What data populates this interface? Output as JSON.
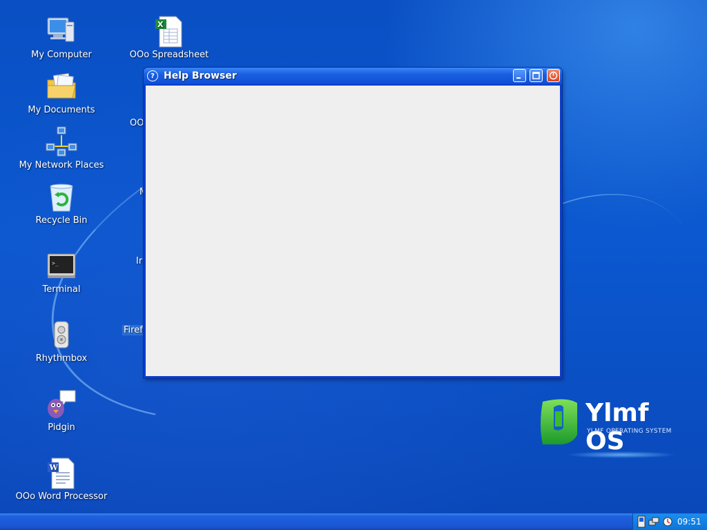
{
  "desktop": {
    "icons": [
      {
        "label": "My Computer",
        "icon": "computer-icon"
      },
      {
        "label": "My Documents",
        "icon": "documents-folder-icon"
      },
      {
        "label": "My Network Places",
        "icon": "network-places-icon"
      },
      {
        "label": "Recycle Bin",
        "icon": "recycle-bin-icon"
      },
      {
        "label": "Terminal",
        "icon": "terminal-icon"
      },
      {
        "label": "Rhythmbox",
        "icon": "rhythmbox-icon"
      },
      {
        "label": "Pidgin",
        "icon": "pidgin-icon"
      },
      {
        "label": "OOo Word Processor",
        "icon": "word-processor-icon"
      },
      {
        "label": "OOo Spreadsheet",
        "icon": "spreadsheet-icon"
      }
    ],
    "partial_labels": [
      "OO",
      "M",
      "Ir",
      "Firef"
    ]
  },
  "window": {
    "title": "Help Browser",
    "help_icon_glyph": "?",
    "buttons": [
      "minimize",
      "maximize",
      "close"
    ]
  },
  "logo": {
    "word": "Ylmf OS",
    "subtitle": "YLMF OPERATING SYSTEM"
  },
  "taskbar": {
    "clock": "09:51",
    "tray_icons": [
      "device-icon",
      "network-icon",
      "updates-icon"
    ]
  },
  "colors": {
    "desktop_blue": "#0b58d0",
    "titlebar_blue": "#1a5fe0",
    "window_content": "#efefef",
    "logo_green": "#3dbb2a",
    "close_button": "#d9431d"
  }
}
